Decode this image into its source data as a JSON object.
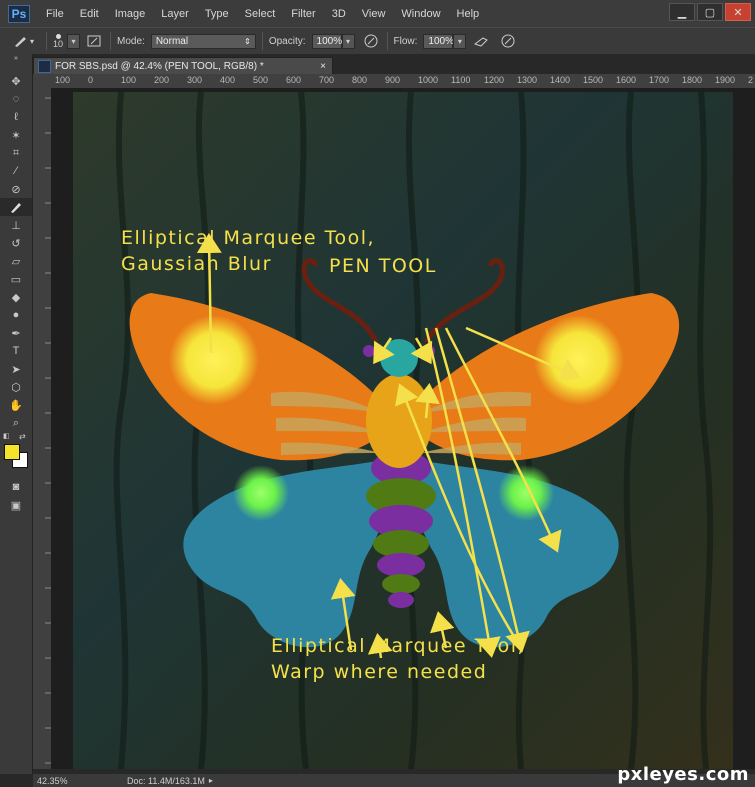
{
  "app": {
    "logo": "Ps"
  },
  "menu": [
    "File",
    "Edit",
    "Image",
    "Layer",
    "Type",
    "Select",
    "Filter",
    "3D",
    "View",
    "Window",
    "Help"
  ],
  "window_controls": [
    "▁",
    "▢",
    "✕"
  ],
  "options": {
    "brush_size": "10",
    "mode_label": "Mode:",
    "mode_value": "Normal",
    "opacity_label": "Opacity:",
    "opacity_value": "100%",
    "flow_label": "Flow:",
    "flow_value": "100%"
  },
  "document": {
    "tab_title": "FOR SBS.psd @ 42.4% (PEN TOOL, RGB/8) *",
    "tab_close": "×"
  },
  "ruler_top_labels": [
    "100",
    "0",
    "100",
    "200",
    "300",
    "400",
    "500",
    "600",
    "700",
    "800",
    "900",
    "1000",
    "1100",
    "1200",
    "1300",
    "1400",
    "1500",
    "1600",
    "1700",
    "1800",
    "1900",
    "2"
  ],
  "annotations": {
    "top_left": "Elliptical Marquee Tool,\nGaussian Blur",
    "pen_tool": "PEN TOOL",
    "bottom": "Elliptical Marquee Tool,\nWarp where needed"
  },
  "status": {
    "zoom": "42.35%",
    "doc": "Doc: 11.4M/163.1M"
  },
  "watermark": "pxleyes.com",
  "colors": {
    "foreground": "#f7e22a",
    "background": "#ffffff",
    "annotation": "#f4e04a"
  }
}
